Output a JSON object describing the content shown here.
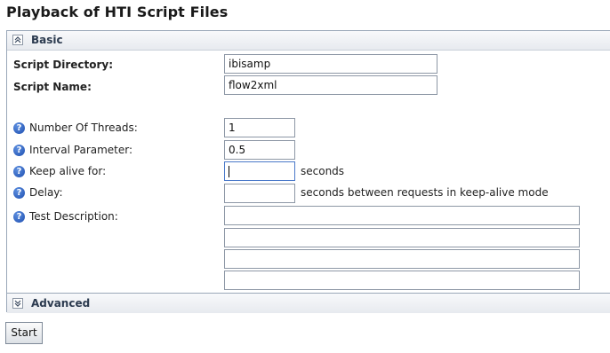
{
  "page": {
    "title": "Playback of HTI Script Files"
  },
  "basic": {
    "header_label": "Basic",
    "script_directory": {
      "label": "Script Directory:",
      "value": "ibisamp"
    },
    "script_name": {
      "label": "Script Name:",
      "value": "flow2xml"
    },
    "number_of_threads": {
      "label": "Number Of Threads:",
      "value": "1"
    },
    "interval_parameter": {
      "label": "Interval Parameter:",
      "value": "0.5"
    },
    "keep_alive": {
      "label": "Keep alive for:",
      "value": "",
      "suffix": "seconds"
    },
    "delay": {
      "label": "Delay:",
      "value": "",
      "suffix": "seconds between requests in keep-alive mode"
    },
    "test_description": {
      "label": "Test Description:",
      "lines": [
        "",
        "",
        "",
        ""
      ]
    },
    "help_icon_glyph": "?"
  },
  "advanced": {
    "header_label": "Advanced"
  },
  "actions": {
    "start_label": "Start"
  },
  "icons": {
    "help": "help-icon",
    "collapse": "chevron-up-icon",
    "expand": "chevron-down-icon"
  },
  "colors": {
    "help_icon": "#1e4fb0",
    "panel_border": "#9aa7b8",
    "header_text": "#2b3a4f"
  }
}
